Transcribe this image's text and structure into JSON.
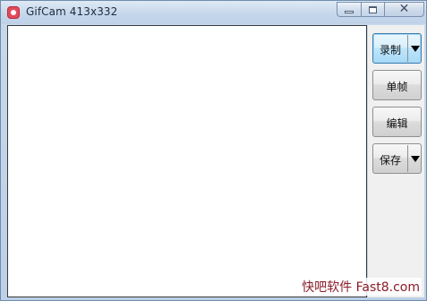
{
  "window": {
    "title": "GifCam 413x332",
    "app_icon": "gifcam-icon",
    "controls": {
      "minimize_icon": "minimize-icon",
      "maximize_icon": "maximize-icon",
      "close_glyph": "✕"
    }
  },
  "sidebar": {
    "record_label": "录制",
    "frame_label": "单帧",
    "edit_label": "编辑",
    "save_label": "保存",
    "dropdown_icon": "triangle-down-icon"
  },
  "watermark": "快吧软件 Fast8.com",
  "colors": {
    "titlebar": "#c4d6ea",
    "active_button_border": "#3c7fb1",
    "watermark_text": "#8a1d2a"
  }
}
